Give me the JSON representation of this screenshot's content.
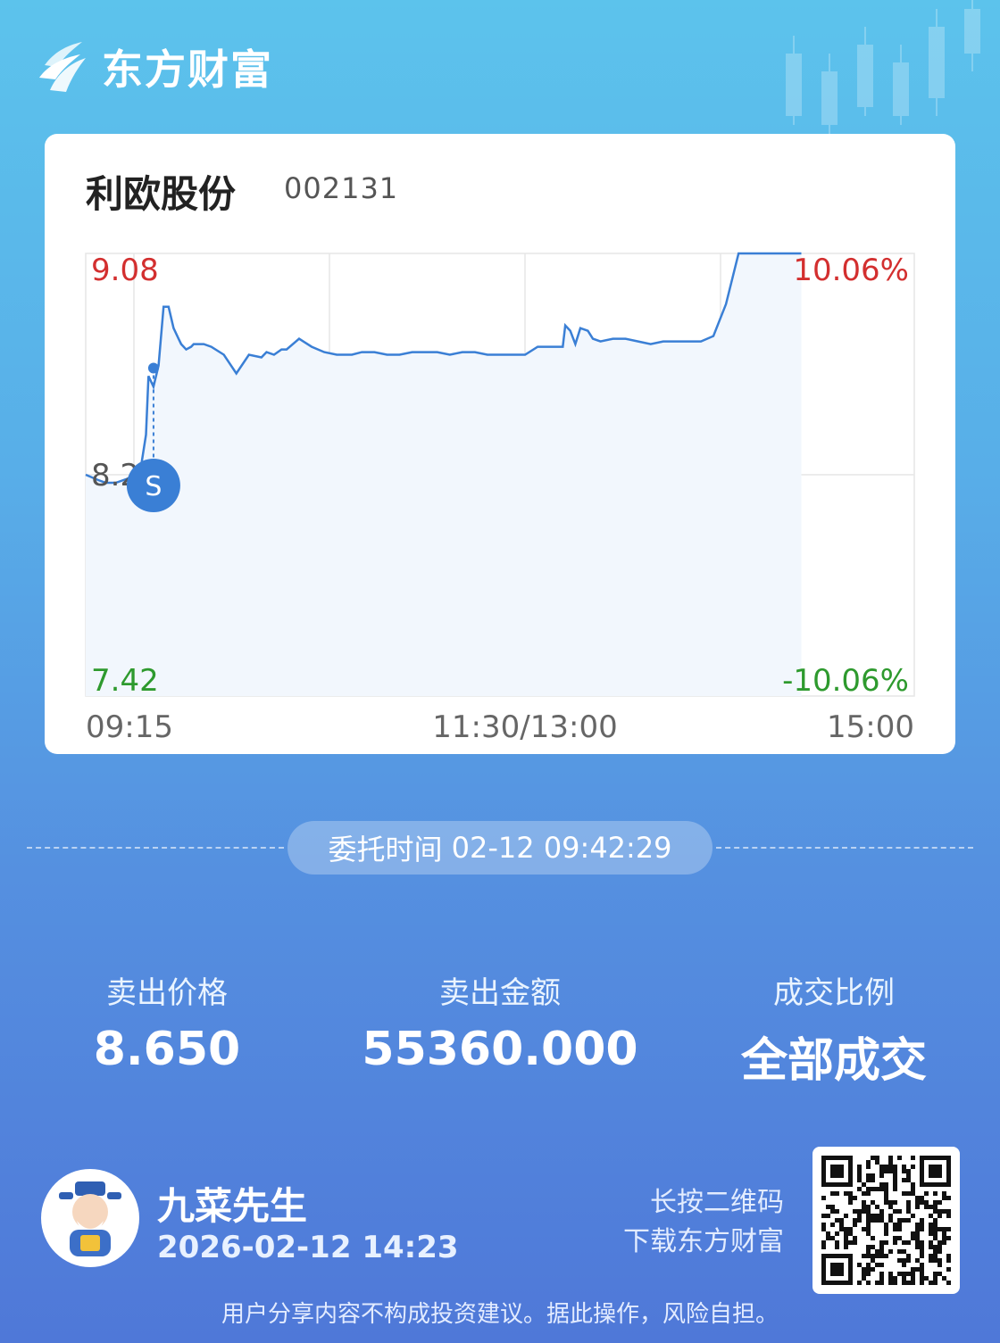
{
  "brand": {
    "name": "东方财富",
    "logo_icon": "eastmoney-logo-icon"
  },
  "stock": {
    "name": "利欧股份",
    "code": "002131"
  },
  "chart_data": {
    "type": "line",
    "price_labels": {
      "high": "9.08",
      "mid": "8.25",
      "low": "7.42"
    },
    "pct_labels": {
      "high": "10.06%",
      "low": "-10.06%"
    },
    "x_labels": [
      "09:15",
      "11:30/13:00",
      "15:00"
    ],
    "ylim": [
      7.42,
      9.08
    ],
    "xlim": [
      0,
      330
    ],
    "prev_close": 8.25,
    "colors": {
      "line": "#3a7fd5",
      "fill": "#f2f7fd",
      "up": "#d32f2f",
      "down": "#2e9a2e",
      "grid": "#e6e6e6"
    },
    "series": [
      {
        "x": [
          0,
          5,
          8,
          10,
          12,
          15,
          18,
          20,
          22,
          24,
          25,
          27,
          29,
          31,
          33,
          35,
          37,
          38,
          40,
          42,
          43,
          44,
          45,
          47,
          50,
          55,
          60,
          65,
          70,
          72,
          75,
          78,
          80,
          85,
          90,
          95,
          100,
          102,
          104,
          106,
          110,
          115,
          120,
          125,
          130,
          135,
          140,
          145,
          150,
          155,
          160,
          165,
          170,
          175,
          180,
          185,
          190,
          191,
          193,
          195,
          197,
          200,
          202,
          205,
          210,
          215,
          220,
          225,
          230,
          235,
          240,
          245,
          250,
          255,
          260,
          265,
          270,
          271,
          273,
          275,
          277,
          280,
          285
        ],
        "values": [
          8.25,
          8.23,
          8.22,
          8.22,
          8.22,
          8.23,
          8.24,
          8.26,
          8.28,
          8.4,
          8.62,
          8.58,
          8.66,
          8.88,
          8.88,
          8.8,
          8.76,
          8.74,
          8.72,
          8.73,
          8.74,
          8.74,
          8.74,
          8.74,
          8.73,
          8.7,
          8.63,
          8.7,
          8.69,
          8.71,
          8.7,
          8.72,
          8.72,
          8.76,
          8.73,
          8.71,
          8.7,
          8.7,
          8.7,
          8.7,
          8.71,
          8.71,
          8.7,
          8.7,
          8.71,
          8.71,
          8.71,
          8.7,
          8.71,
          8.71,
          8.7,
          8.7,
          8.7,
          8.7,
          8.73,
          8.73,
          8.73,
          8.81,
          8.79,
          8.74,
          8.8,
          8.79,
          8.76,
          8.75,
          8.76,
          8.76,
          8.75,
          8.74,
          8.75,
          8.75,
          8.75,
          8.75,
          8.77,
          8.89,
          9.08,
          9.08,
          9.08,
          9.08,
          9.08,
          9.08,
          9.08,
          9.08,
          9.08
        ]
      }
    ],
    "sell_marker": {
      "x": 27,
      "price": 8.65,
      "label": "S"
    }
  },
  "order": {
    "label": "委托时间",
    "datetime": "02-12 09:42:29"
  },
  "stats": [
    {
      "label": "卖出价格",
      "value": "8.650"
    },
    {
      "label": "卖出金额",
      "value": "55360.000"
    },
    {
      "label": "成交比例",
      "value": "全部成交"
    }
  ],
  "user": {
    "name": "九菜先生",
    "share_time": "2026-02-12 14:23",
    "avatar_icon": "cartoon-avatar-icon"
  },
  "qr": {
    "hint_line1": "长按二维码",
    "hint_line2": "下载东方财富",
    "icon": "qr-code-icon"
  },
  "disclaimer": "用户分享内容不构成投资建议。据此操作，风险自担。"
}
